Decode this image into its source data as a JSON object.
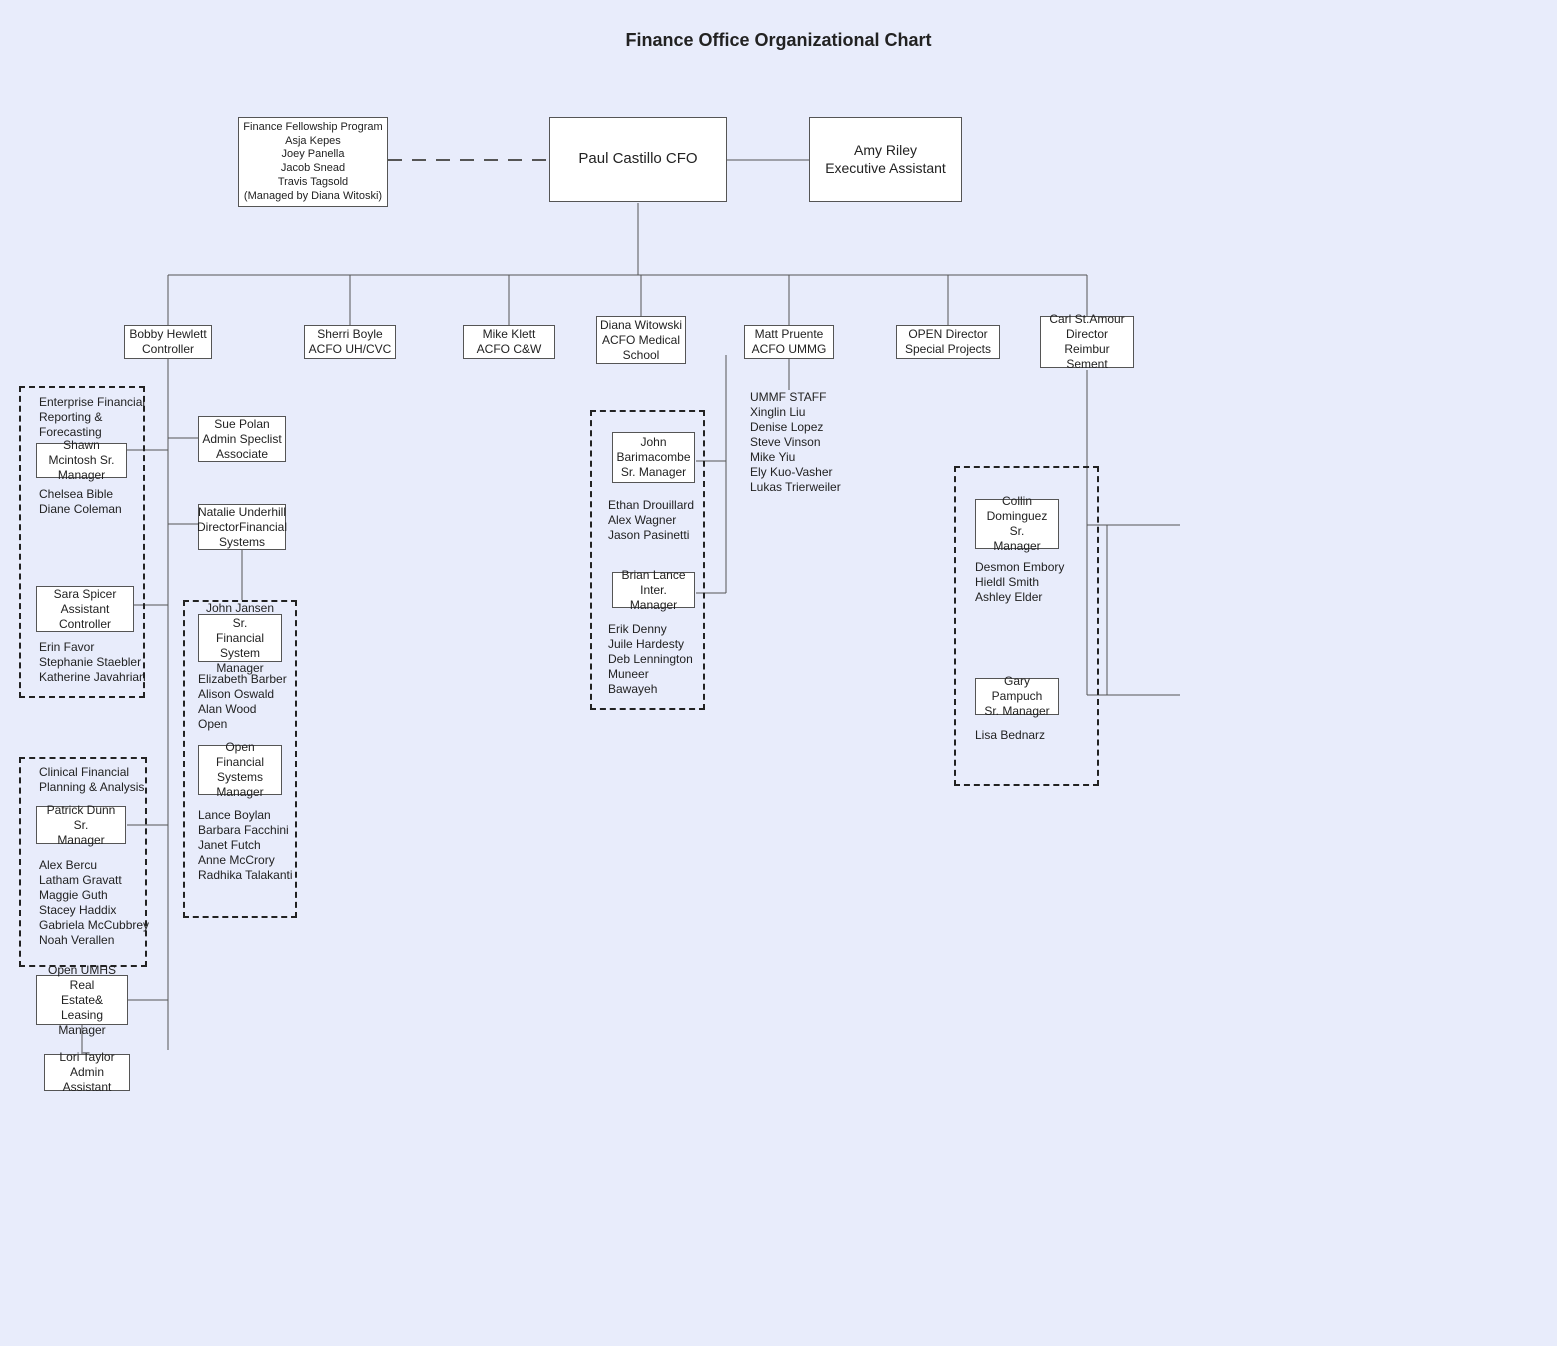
{
  "title": "Finance Office Organizational Chart",
  "fellowship": "Finance Fellowship Program\nAsja Kepes\nJoey Panella\nJacob Snead\nTravis Tagsold\n(Managed by Diana Witoski)",
  "cfo": "Paul Castillo CFO",
  "exec_asst": "Amy Riley\nExecutive Assistant",
  "bobby": "Bobby Hewlett\nController",
  "sherri": "Sherri Boyle\nACFO UH/CVC",
  "mike": "Mike Klett\nACFO C&W",
  "diana": "Diana Witowski\nACFO Medical School",
  "matt": "Matt Pruente\nACFO UMMG",
  "open_dir": "OPEN Director\nSpecial Projects",
  "carl": "Carl St.Amour\nDirector\nReimbur Sement",
  "eff_title": "Enterprise Financial\nReporting &\nForecasting",
  "shawn": "Shawn Mcintosh Sr.\nManager",
  "shawn_reports": "Chelsea Bible\nDiane Coleman",
  "sue": "Sue Polan\nAdmin Speclist\nAssociate",
  "natalie": "Natalie Underhill\nDirectorFinancial\nSystems",
  "sara": "Sara Spicer\nAssistant\nController",
  "sara_reports": "Erin Favor\nStephanie Staebler\nKatherine Javahrian",
  "cfpa_title": "Clinical Financial\nPlanning & Analysis",
  "patrick": "Patrick Dunn Sr.\nManager",
  "patrick_reports": "Alex Bercu\nLatham Gravatt\nMaggie Guth\nStacey Haddix\nGabriela McCubbrey\nNoah Verallen",
  "open_umhs": "Open UMHS Real\nEstate& Leasing\nManager",
  "lori": "Lori Taylor\nAdmin Assistant",
  "john_j": "John Jansen Sr.\nFinancial System\nManager",
  "john_j_reports": "Elizabeth Barber\nAlison Oswald\nAlan Wood\nOpen",
  "open_fin": "Open Financial\nSystems\nManager",
  "open_fin_reports": "Lance Boylan\nBarbara Facchini\nJanet Futch\nAnne McCrory\nRadhika Talakanti",
  "john_b": "John\nBarimacombe\nSr. Manager",
  "john_b_reports": "Ethan Drouillard\nAlex Wagner\nJason Pasinetti",
  "brian": "Brian Lance\nInter. Manager",
  "brian_reports": "Erik Denny\nJuile Hardesty\nDeb Lennington\nMuneer\nBawayeh",
  "ummf": "UMMF STAFF\nXinglin Liu\nDenise Lopez\nSteve Vinson\nMike Yiu\nEly Kuo-Vasher\nLukas Trierweiler",
  "collin": "Collin\nDominguez Sr.\nManager",
  "collin_reports": "Desmon Embory\nHieldl Smith\nAshley Elder",
  "gary": "Gary Pampuch\nSr. Manager",
  "gary_reports": "Lisa Bednarz"
}
